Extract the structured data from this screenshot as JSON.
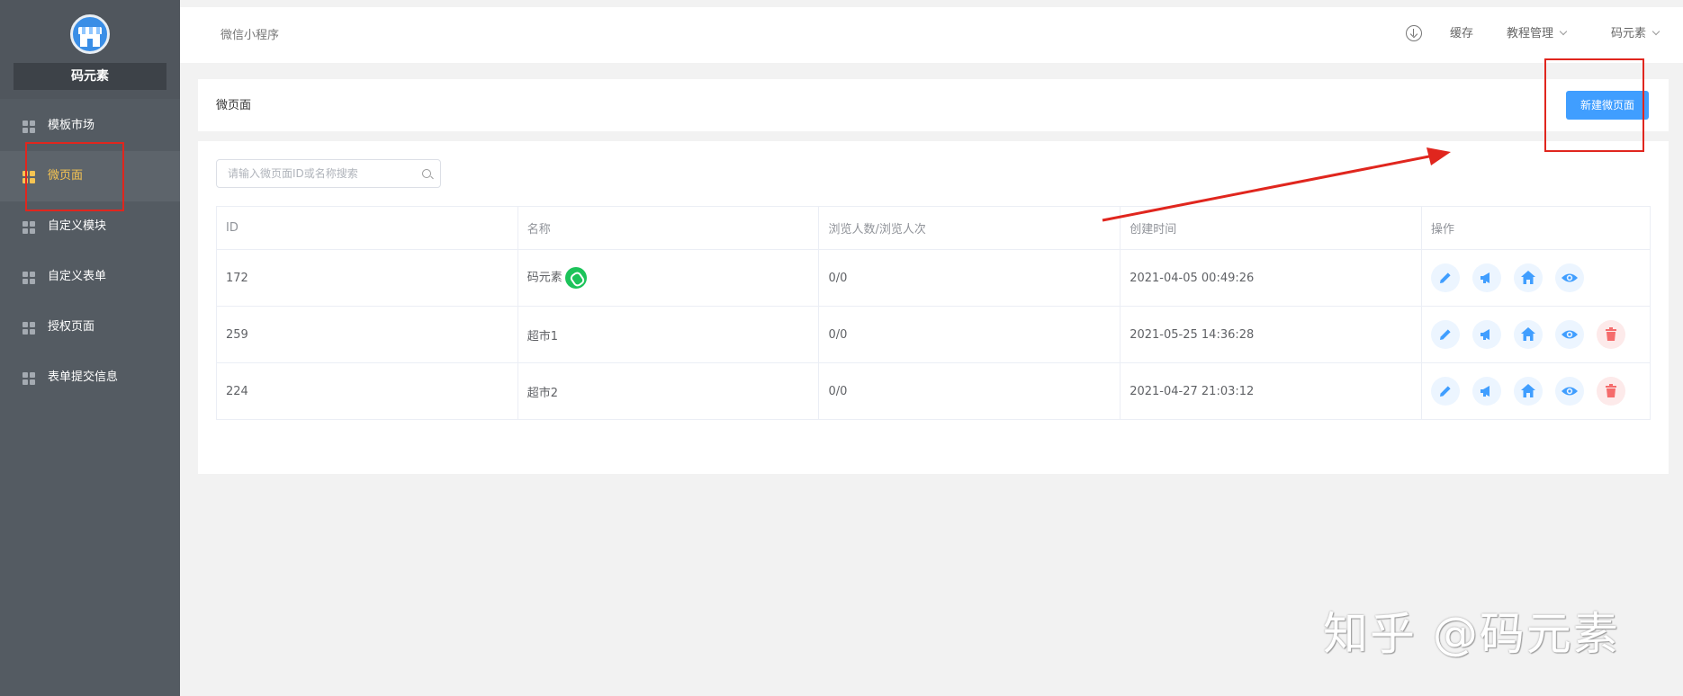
{
  "sidebar": {
    "brand": "码元素",
    "items": [
      {
        "label": "模板市场"
      },
      {
        "label": "微页面"
      },
      {
        "label": "自定义模块"
      },
      {
        "label": "自定义表单"
      },
      {
        "label": "授权页面"
      },
      {
        "label": "表单提交信息"
      }
    ]
  },
  "topbar": {
    "title": "微信小程序",
    "cache": "缓存",
    "tutorial": "教程管理",
    "user": "码元素"
  },
  "page": {
    "title": "微页面",
    "new_button": "新建微页面"
  },
  "search": {
    "placeholder": "请输入微页面ID或名称搜索"
  },
  "table": {
    "headers": [
      "ID",
      "名称",
      "浏览人数/浏览人次",
      "创建时间",
      "操作"
    ],
    "rows": [
      {
        "id": "172",
        "name": "码元素",
        "views": "0/0",
        "created": "2021-04-05 00:49:26"
      },
      {
        "id": "259",
        "name": "超市1",
        "views": "0/0",
        "created": "2021-05-25 14:36:28"
      },
      {
        "id": "224",
        "name": "超市2",
        "views": "0/0",
        "created": "2021-04-27 21:03:12"
      }
    ]
  },
  "watermark": "知乎 @码元素",
  "colors": {
    "sidebar": "#545b62",
    "active": "#f6c453",
    "primary": "#409eff",
    "annotation": "#e0261e"
  }
}
